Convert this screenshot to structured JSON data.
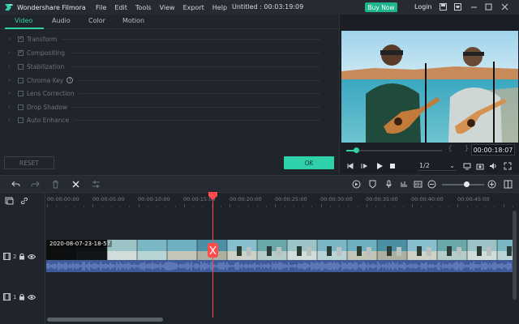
{
  "titlebar": {
    "app_name": "Wondershare Filmora",
    "menu": [
      "File",
      "Edit",
      "Tools",
      "View",
      "Export",
      "Help"
    ],
    "window_title": "Untitled : 00:03:19:09",
    "buy_now": "Buy Now",
    "login": "Login",
    "icons": [
      "save-icon",
      "cart-icon",
      "minimize-icon",
      "maximize-icon",
      "close-icon"
    ]
  },
  "tabs": [
    {
      "label": "Video",
      "active": true
    },
    {
      "label": "Audio",
      "active": false
    },
    {
      "label": "Color",
      "active": false
    },
    {
      "label": "Motion",
      "active": false
    }
  ],
  "properties": [
    {
      "label": "Transform",
      "checked": true
    },
    {
      "label": "Compositing",
      "checked": true
    },
    {
      "label": "Stabilization",
      "checked": false
    },
    {
      "label": "Chroma Key",
      "checked": false
    },
    {
      "label": "Lens Correction",
      "checked": false
    },
    {
      "label": "Drop Shadow",
      "checked": false
    },
    {
      "label": "Auto Enhance",
      "checked": false
    }
  ],
  "buttons": {
    "reset": "RESET",
    "ok": "OK"
  },
  "preview": {
    "timecode": "00:00:18:07",
    "ratio": "1/2",
    "progress": 0.1,
    "brackets": "{ }"
  },
  "timeline": {
    "ruler": [
      "00:00:00:00",
      "00:00:05:00",
      "00:00:10:00",
      "00:00:15:00",
      "00:00:20:00",
      "00:00:25:00",
      "00:00:30:00",
      "00:00:35:00",
      "00:00:40:00",
      "00:00:45:00"
    ],
    "tracks": [
      {
        "number": "2",
        "clip_label": "2020-08-07-23-18-57"
      },
      {
        "number": "1",
        "clip_label": ""
      }
    ],
    "colors": {
      "playhead": "#ff4b4b",
      "accent": "#2fd1ab",
      "audio": "#3f5a9a"
    }
  }
}
